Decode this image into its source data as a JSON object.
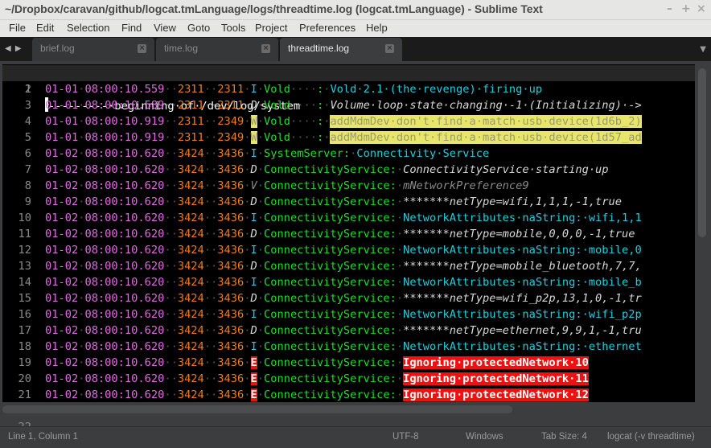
{
  "window": {
    "title": "~/Dropbox/caravan/github/logcat.tmLanguage/logs/threadtime.log (logcat.tmLanguage) - Sublime Text",
    "controls": {
      "minimize": "–",
      "maximize": "+",
      "close": "×"
    }
  },
  "menu": [
    "File",
    "Edit",
    "Selection",
    "Find",
    "View",
    "Goto",
    "Tools",
    "Project",
    "Preferences",
    "Help"
  ],
  "tabs": [
    {
      "label": "brief.log",
      "active": false
    },
    {
      "label": "time.log",
      "active": false
    },
    {
      "label": "threadtime.log",
      "active": true
    }
  ],
  "tab_nav": {
    "arrows": "◀ ▶",
    "dropdown": "▼",
    "close_glyph": "×"
  },
  "editor": {
    "header_line": "--------- beginning of /dev/log/system",
    "lines": [
      {
        "n": "2",
        "date": "01-01",
        "time": "08:00:10.559",
        "pid": "2311",
        "tid": "2311",
        "level": "I",
        "tag": "Vold",
        "tag_pad": "    ",
        "message": "Vold 2.1 (the revenge) firing up"
      },
      {
        "n": "3",
        "date": "01-01",
        "time": "08:00:10.589",
        "pid": "2311",
        "tid": "2311",
        "level": "D",
        "tag": "Vold",
        "tag_pad": "    ",
        "message": "Volume loop state changing -1 (Initializing) ->"
      },
      {
        "n": "4",
        "date": "01-01",
        "time": "08:00:10.919",
        "pid": "2311",
        "tid": "2349",
        "level": "W",
        "tag": "Vold",
        "tag_pad": "    ",
        "message": "addMdmDev don't find a match usb device(1d6b_2)"
      },
      {
        "n": "5",
        "date": "01-01",
        "time": "08:00:10.919",
        "pid": "2311",
        "tid": "2349",
        "level": "W",
        "tag": "Vold",
        "tag_pad": "    ",
        "message": "addMdmDev don't find a match usb device(1d57_ad"
      },
      {
        "n": "6",
        "date": "01-02",
        "time": "08:00:10.620",
        "pid": "3424",
        "tid": "3436",
        "level": "I",
        "tag": "SystemServer",
        "tag_pad": "",
        "message": "Connectivity Service"
      },
      {
        "n": "7",
        "date": "01-02",
        "time": "08:00:10.620",
        "pid": "3424",
        "tid": "3436",
        "level": "D",
        "tag": "ConnectivityService",
        "tag_pad": "",
        "message": "ConnectivityService starting up"
      },
      {
        "n": "8",
        "date": "01-02",
        "time": "08:00:10.620",
        "pid": "3424",
        "tid": "3436",
        "level": "V",
        "tag": "ConnectivityService",
        "tag_pad": "",
        "message": "mNetworkPreference9"
      },
      {
        "n": "9",
        "date": "01-02",
        "time": "08:00:10.620",
        "pid": "3424",
        "tid": "3436",
        "level": "D",
        "tag": "ConnectivityService",
        "tag_pad": "",
        "message": "*******netType=wifi,1,1,1,-1,true"
      },
      {
        "n": "10",
        "date": "01-02",
        "time": "08:00:10.620",
        "pid": "3424",
        "tid": "3436",
        "level": "I",
        "tag": "ConnectivityService",
        "tag_pad": "",
        "message": "NetworkAttributes naString: wifi,1,1"
      },
      {
        "n": "11",
        "date": "01-02",
        "time": "08:00:10.620",
        "pid": "3424",
        "tid": "3436",
        "level": "D",
        "tag": "ConnectivityService",
        "tag_pad": "",
        "message": "*******netType=mobile,0,0,0,-1,true"
      },
      {
        "n": "12",
        "date": "01-02",
        "time": "08:00:10.620",
        "pid": "3424",
        "tid": "3436",
        "level": "I",
        "tag": "ConnectivityService",
        "tag_pad": "",
        "message": "NetworkAttributes naString: mobile,0"
      },
      {
        "n": "13",
        "date": "01-02",
        "time": "08:00:10.620",
        "pid": "3424",
        "tid": "3436",
        "level": "D",
        "tag": "ConnectivityService",
        "tag_pad": "",
        "message": "*******netType=mobile_bluetooth,7,7,"
      },
      {
        "n": "14",
        "date": "01-02",
        "time": "08:00:10.620",
        "pid": "3424",
        "tid": "3436",
        "level": "I",
        "tag": "ConnectivityService",
        "tag_pad": "",
        "message": "NetworkAttributes naString: mobile_b"
      },
      {
        "n": "15",
        "date": "01-02",
        "time": "08:00:10.620",
        "pid": "3424",
        "tid": "3436",
        "level": "D",
        "tag": "ConnectivityService",
        "tag_pad": "",
        "message": "*******netType=wifi_p2p,13,1,0,-1,tr"
      },
      {
        "n": "16",
        "date": "01-02",
        "time": "08:00:10.620",
        "pid": "3424",
        "tid": "3436",
        "level": "I",
        "tag": "ConnectivityService",
        "tag_pad": "",
        "message": "NetworkAttributes naString: wifi_p2p"
      },
      {
        "n": "17",
        "date": "01-02",
        "time": "08:00:10.620",
        "pid": "3424",
        "tid": "3436",
        "level": "D",
        "tag": "ConnectivityService",
        "tag_pad": "",
        "message": "*******netType=ethernet,9,9,1,-1,tru"
      },
      {
        "n": "18",
        "date": "01-02",
        "time": "08:00:10.620",
        "pid": "3424",
        "tid": "3436",
        "level": "I",
        "tag": "ConnectivityService",
        "tag_pad": "",
        "message": "NetworkAttributes naString: ethernet"
      },
      {
        "n": "19",
        "date": "01-02",
        "time": "08:00:10.620",
        "pid": "3424",
        "tid": "3436",
        "level": "E",
        "tag": "ConnectivityService",
        "tag_pad": "",
        "message": "Ignoring protectedNetwork 10"
      },
      {
        "n": "20",
        "date": "01-02",
        "time": "08:00:10.620",
        "pid": "3424",
        "tid": "3436",
        "level": "E",
        "tag": "ConnectivityService",
        "tag_pad": "",
        "message": "Ignoring protectedNetwork 11"
      },
      {
        "n": "21",
        "date": "01-02",
        "time": "08:00:10.620",
        "pid": "3424",
        "tid": "3436",
        "level": "E",
        "tag": "ConnectivityService",
        "tag_pad": "",
        "message": "Ignoring protectedNetwork 12"
      }
    ],
    "line_numbers": {
      "first": "1",
      "last": "22"
    }
  },
  "status": {
    "position": "Line 1, Column 1",
    "encoding": "UTF-8",
    "line_endings": "Windows",
    "tab_size": "Tab Size: 4",
    "syntax": "logcat (-v threadtime)"
  },
  "colors": {
    "date": "#e36ae3",
    "pid": "#f07c10",
    "tag": "#1fdd2a",
    "info": "#1ccfe0",
    "warn_bg": "#e8e66a",
    "error_bg": "#f01010"
  }
}
